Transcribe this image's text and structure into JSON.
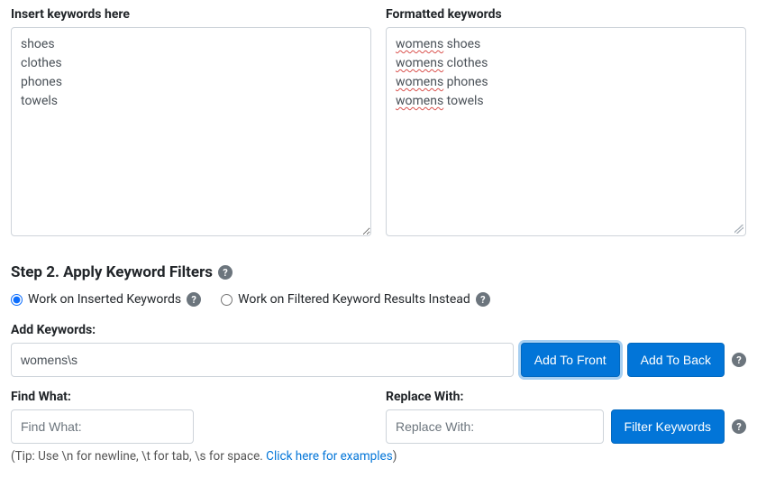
{
  "inputKeywords": {
    "label": "Insert keywords here",
    "value": "shoes\nclothes\nphones\ntowels"
  },
  "outputKeywords": {
    "label": "Formatted keywords",
    "lines": [
      {
        "prefix": "womens",
        "rest": " shoes"
      },
      {
        "prefix": "womens",
        "rest": " clothes"
      },
      {
        "prefix": "womens",
        "rest": " phones"
      },
      {
        "prefix": "womens",
        "rest": " towels"
      }
    ]
  },
  "step2": {
    "heading": "Step 2. Apply Keyword Filters",
    "radios": {
      "inserted": "Work on Inserted Keywords",
      "filtered": "Work on Filtered Keyword Results Instead",
      "selected": "inserted"
    },
    "addKeywords": {
      "label": "Add Keywords:",
      "value": "womens\\s",
      "front": "Add To Front",
      "back": "Add To Back"
    },
    "find": {
      "label": "Find What:",
      "placeholder": "Find What:"
    },
    "replace": {
      "label": "Replace With:",
      "placeholder": "Replace With:"
    },
    "filterBtn": "Filter Keywords",
    "tip": {
      "prefix": "(Tip: Use \\n for newline, \\t for tab, \\s for space.  ",
      "link": "Click here for examples",
      "suffix": ")"
    }
  },
  "helpGlyph": "?"
}
